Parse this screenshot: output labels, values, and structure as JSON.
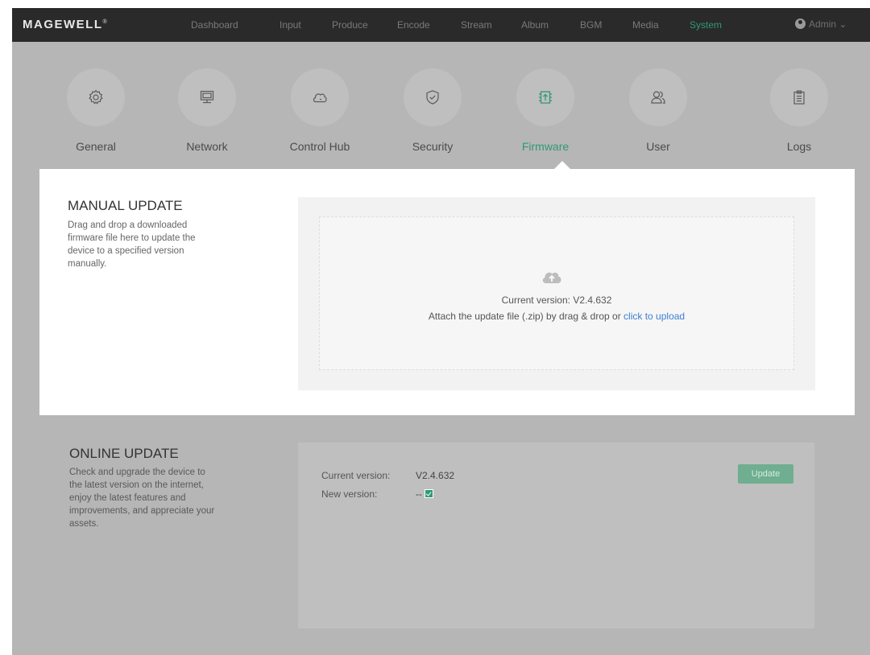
{
  "header": {
    "logo": "MAGEWELL",
    "logo_mark": "®",
    "nav": [
      {
        "label": "Dashboard",
        "active": false
      },
      {
        "label": "Input",
        "active": false
      },
      {
        "label": "Produce",
        "active": false
      },
      {
        "label": "Encode",
        "active": false
      },
      {
        "label": "Stream",
        "active": false
      },
      {
        "label": "Album",
        "active": false
      },
      {
        "label": "BGM",
        "active": false
      },
      {
        "label": "Media",
        "active": false
      },
      {
        "label": "System",
        "active": true
      }
    ],
    "user": "Admin",
    "user_caret": "⌄"
  },
  "tabs": [
    {
      "label": "General",
      "icon": "gear-icon"
    },
    {
      "label": "Network",
      "icon": "monitor-icon"
    },
    {
      "label": "Control Hub",
      "icon": "cloud-icon"
    },
    {
      "label": "Security",
      "icon": "shield-icon"
    },
    {
      "label": "Firmware",
      "icon": "chip-upload-icon",
      "active": true
    },
    {
      "label": "User",
      "icon": "users-icon"
    },
    {
      "label": "Logs",
      "icon": "clipboard-icon"
    }
  ],
  "manual_update": {
    "title": "MANUAL UPDATE",
    "desc_lines": [
      "Drag and drop a downloaded",
      "firmware file here to update the",
      "device to a specified version",
      "manually."
    ],
    "current_version_text": "Current version: V2.4.632",
    "attach_text": "Attach the update file (.zip) by drag & drop or ",
    "upload_link": "click to upload"
  },
  "online_update": {
    "title": "ONLINE UPDATE",
    "desc_lines": [
      "Check and upgrade the device to",
      "the latest version on the internet,",
      "enjoy the latest features and",
      "improvements, and appreciate your",
      "assets."
    ],
    "current_version_label": "Current version:",
    "current_version_value": "V2.4.632",
    "new_version_label": "New version:",
    "new_version_value": "--",
    "update_button": "Update"
  },
  "colors": {
    "accent": "#2f9a73",
    "link": "#3d7fd0",
    "nav_bg": "#2a2a2a",
    "overlay_bg": "#b6b6b6"
  }
}
